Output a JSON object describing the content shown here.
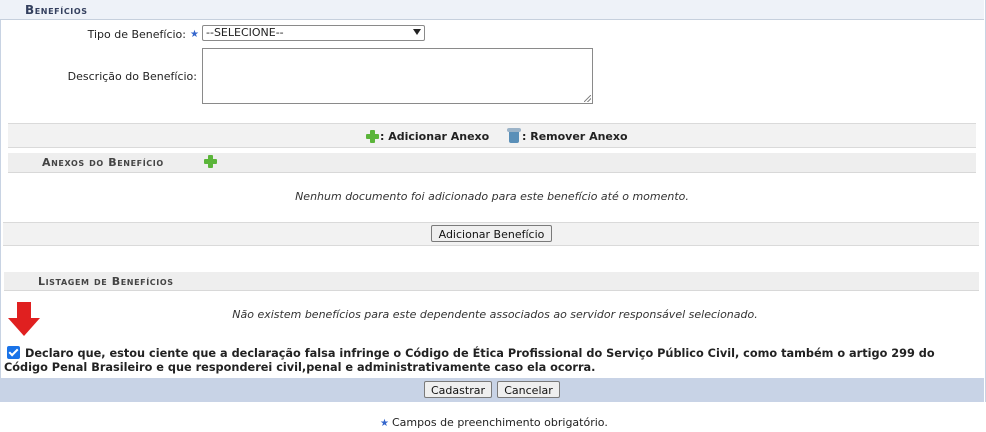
{
  "header": {
    "title": "Benefícios"
  },
  "form": {
    "tipo_label": "Tipo de Benefício:",
    "required_star": "★",
    "tipo_value": "--SELECIONE--",
    "descricao_label": "Descrição do Benefício:"
  },
  "anexo_bar": {
    "add_label": ": Adicionar Anexo",
    "remove_label": ": Remover Anexo"
  },
  "anexos": {
    "title": "Anexos do Benefício",
    "empty_message": "Nenhum documento foi adicionado para este benefício até o momento."
  },
  "add_benefit_button": "Adicionar Benefício",
  "listagem": {
    "title": "Listagem de Benefícios",
    "empty_message": "Não existem benefícios para este dependente associados ao servidor responsável selecionado."
  },
  "declaration": {
    "checked": true,
    "text": "Declaro que, estou ciente que a declaração falsa infringe o Código de Ética Profissional do Serviço Público Civil, como também o artigo 299 do Código Penal Brasileiro e que responderei civil,penal e administrativamente caso ela ocorra."
  },
  "actions": {
    "submit": "Cadastrar",
    "cancel": "Cancelar"
  },
  "footer_note": "Campos de preenchimento obrigatório.",
  "colors": {
    "header_bg": "#eef2f8",
    "footer_bar": "#c8d3e6",
    "star": "#3466cc",
    "arrow": "#e02020",
    "plus": "#5bb53a"
  }
}
